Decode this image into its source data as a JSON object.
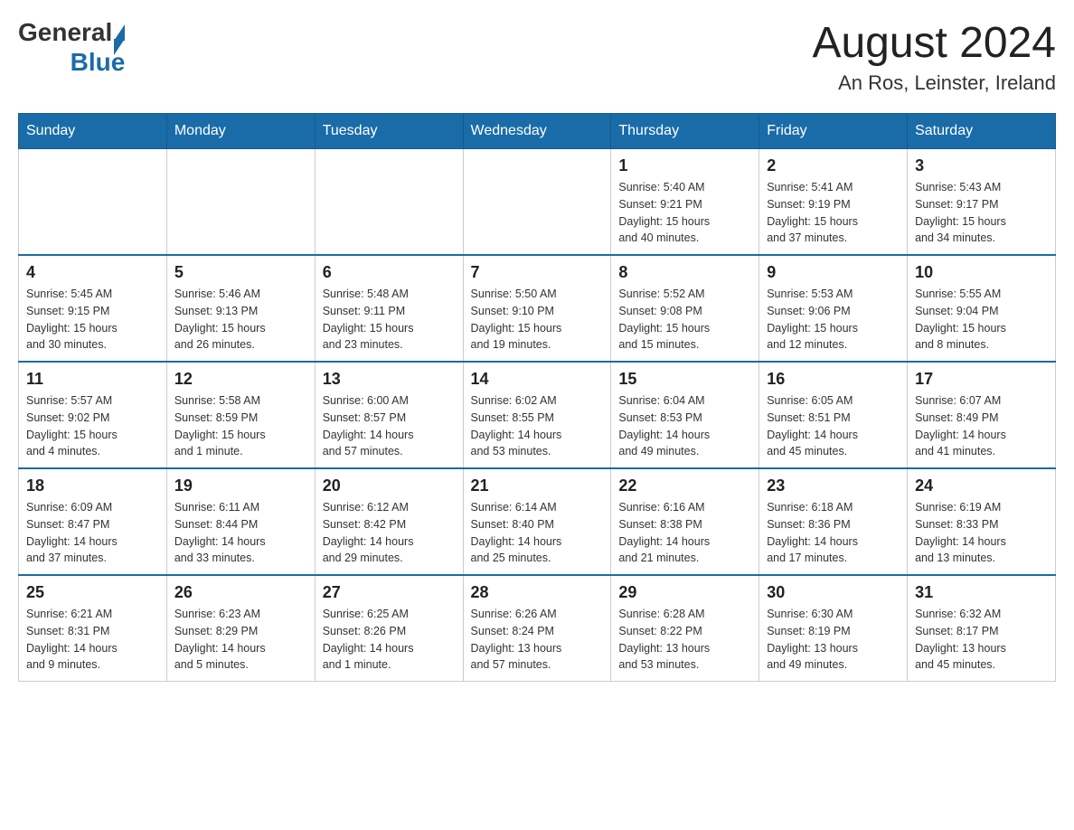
{
  "header": {
    "logo_general": "General",
    "logo_blue": "Blue",
    "title": "August 2024",
    "subtitle": "An Ros, Leinster, Ireland"
  },
  "days_of_week": [
    "Sunday",
    "Monday",
    "Tuesday",
    "Wednesday",
    "Thursday",
    "Friday",
    "Saturday"
  ],
  "weeks": [
    [
      {
        "day": "",
        "info": ""
      },
      {
        "day": "",
        "info": ""
      },
      {
        "day": "",
        "info": ""
      },
      {
        "day": "",
        "info": ""
      },
      {
        "day": "1",
        "info": "Sunrise: 5:40 AM\nSunset: 9:21 PM\nDaylight: 15 hours\nand 40 minutes."
      },
      {
        "day": "2",
        "info": "Sunrise: 5:41 AM\nSunset: 9:19 PM\nDaylight: 15 hours\nand 37 minutes."
      },
      {
        "day": "3",
        "info": "Sunrise: 5:43 AM\nSunset: 9:17 PM\nDaylight: 15 hours\nand 34 minutes."
      }
    ],
    [
      {
        "day": "4",
        "info": "Sunrise: 5:45 AM\nSunset: 9:15 PM\nDaylight: 15 hours\nand 30 minutes."
      },
      {
        "day": "5",
        "info": "Sunrise: 5:46 AM\nSunset: 9:13 PM\nDaylight: 15 hours\nand 26 minutes."
      },
      {
        "day": "6",
        "info": "Sunrise: 5:48 AM\nSunset: 9:11 PM\nDaylight: 15 hours\nand 23 minutes."
      },
      {
        "day": "7",
        "info": "Sunrise: 5:50 AM\nSunset: 9:10 PM\nDaylight: 15 hours\nand 19 minutes."
      },
      {
        "day": "8",
        "info": "Sunrise: 5:52 AM\nSunset: 9:08 PM\nDaylight: 15 hours\nand 15 minutes."
      },
      {
        "day": "9",
        "info": "Sunrise: 5:53 AM\nSunset: 9:06 PM\nDaylight: 15 hours\nand 12 minutes."
      },
      {
        "day": "10",
        "info": "Sunrise: 5:55 AM\nSunset: 9:04 PM\nDaylight: 15 hours\nand 8 minutes."
      }
    ],
    [
      {
        "day": "11",
        "info": "Sunrise: 5:57 AM\nSunset: 9:02 PM\nDaylight: 15 hours\nand 4 minutes."
      },
      {
        "day": "12",
        "info": "Sunrise: 5:58 AM\nSunset: 8:59 PM\nDaylight: 15 hours\nand 1 minute."
      },
      {
        "day": "13",
        "info": "Sunrise: 6:00 AM\nSunset: 8:57 PM\nDaylight: 14 hours\nand 57 minutes."
      },
      {
        "day": "14",
        "info": "Sunrise: 6:02 AM\nSunset: 8:55 PM\nDaylight: 14 hours\nand 53 minutes."
      },
      {
        "day": "15",
        "info": "Sunrise: 6:04 AM\nSunset: 8:53 PM\nDaylight: 14 hours\nand 49 minutes."
      },
      {
        "day": "16",
        "info": "Sunrise: 6:05 AM\nSunset: 8:51 PM\nDaylight: 14 hours\nand 45 minutes."
      },
      {
        "day": "17",
        "info": "Sunrise: 6:07 AM\nSunset: 8:49 PM\nDaylight: 14 hours\nand 41 minutes."
      }
    ],
    [
      {
        "day": "18",
        "info": "Sunrise: 6:09 AM\nSunset: 8:47 PM\nDaylight: 14 hours\nand 37 minutes."
      },
      {
        "day": "19",
        "info": "Sunrise: 6:11 AM\nSunset: 8:44 PM\nDaylight: 14 hours\nand 33 minutes."
      },
      {
        "day": "20",
        "info": "Sunrise: 6:12 AM\nSunset: 8:42 PM\nDaylight: 14 hours\nand 29 minutes."
      },
      {
        "day": "21",
        "info": "Sunrise: 6:14 AM\nSunset: 8:40 PM\nDaylight: 14 hours\nand 25 minutes."
      },
      {
        "day": "22",
        "info": "Sunrise: 6:16 AM\nSunset: 8:38 PM\nDaylight: 14 hours\nand 21 minutes."
      },
      {
        "day": "23",
        "info": "Sunrise: 6:18 AM\nSunset: 8:36 PM\nDaylight: 14 hours\nand 17 minutes."
      },
      {
        "day": "24",
        "info": "Sunrise: 6:19 AM\nSunset: 8:33 PM\nDaylight: 14 hours\nand 13 minutes."
      }
    ],
    [
      {
        "day": "25",
        "info": "Sunrise: 6:21 AM\nSunset: 8:31 PM\nDaylight: 14 hours\nand 9 minutes."
      },
      {
        "day": "26",
        "info": "Sunrise: 6:23 AM\nSunset: 8:29 PM\nDaylight: 14 hours\nand 5 minutes."
      },
      {
        "day": "27",
        "info": "Sunrise: 6:25 AM\nSunset: 8:26 PM\nDaylight: 14 hours\nand 1 minute."
      },
      {
        "day": "28",
        "info": "Sunrise: 6:26 AM\nSunset: 8:24 PM\nDaylight: 13 hours\nand 57 minutes."
      },
      {
        "day": "29",
        "info": "Sunrise: 6:28 AM\nSunset: 8:22 PM\nDaylight: 13 hours\nand 53 minutes."
      },
      {
        "day": "30",
        "info": "Sunrise: 6:30 AM\nSunset: 8:19 PM\nDaylight: 13 hours\nand 49 minutes."
      },
      {
        "day": "31",
        "info": "Sunrise: 6:32 AM\nSunset: 8:17 PM\nDaylight: 13 hours\nand 45 minutes."
      }
    ]
  ]
}
